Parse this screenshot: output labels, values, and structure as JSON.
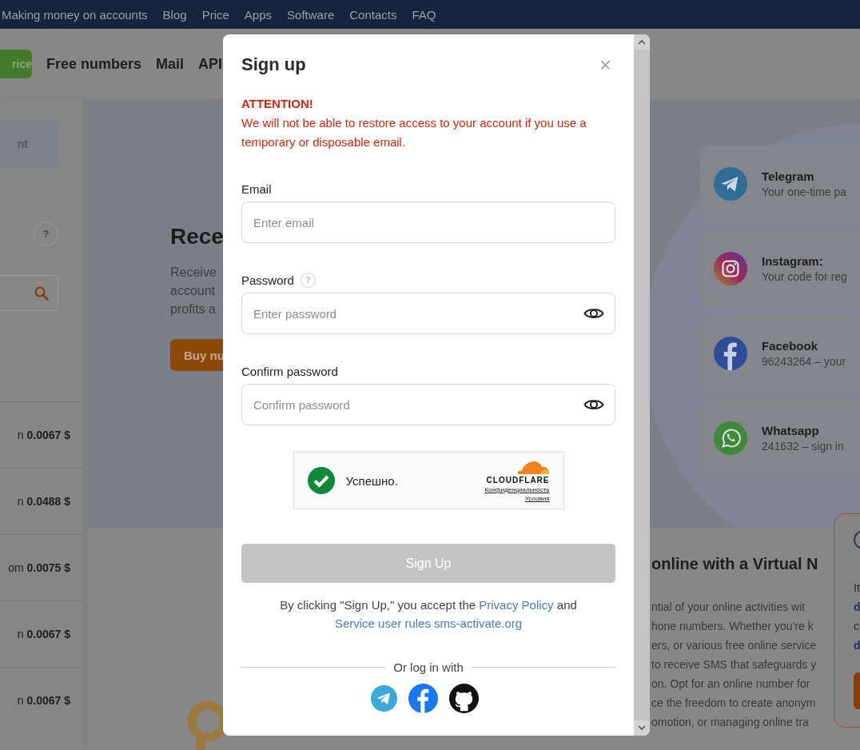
{
  "nav": {
    "links": [
      "Making money on accounts",
      "Blog",
      "Price",
      "Apps",
      "Software",
      "Contacts",
      "FAQ"
    ]
  },
  "header": {
    "price_button": "rice",
    "links": [
      "Free numbers",
      "Mail",
      "API"
    ]
  },
  "sidebar": {
    "tab": "nt",
    "help": "?",
    "price_rows": [
      {
        "prefix": "n",
        "price": "0.0067 $"
      },
      {
        "prefix": "n",
        "price": "0.0488 $"
      },
      {
        "prefix": "om",
        "price": "0.0075 $"
      },
      {
        "prefix": "n",
        "price": "0.0067 $"
      },
      {
        "prefix": "n",
        "price": "0.0067 $"
      }
    ]
  },
  "hero": {
    "title": "Rece",
    "text_lines": [
      "Receive",
      "account",
      "profits a"
    ],
    "button": "Buy nu"
  },
  "service_cards": [
    {
      "kind": "telegram",
      "name": "Telegram",
      "text": "Your one-time pa"
    },
    {
      "kind": "instagram",
      "name": "Instagram:",
      "text": "Your code for reg"
    },
    {
      "kind": "facebook",
      "name": "Facebook",
      "text": "96243264 – your"
    },
    {
      "kind": "whatsapp",
      "name": "Whatsapp",
      "text": "241632 – sign in"
    }
  ],
  "article": {
    "heading": "online with a Virtual N",
    "lines": [
      "ntial of your online activities wit",
      "hone numbers. Whether you're k",
      "ers, or various free online service",
      "to receive SMS that safeguards y",
      "on. Opt for an online number for",
      "ce the freedom to create anonym",
      "omotion, or managing online tra"
    ]
  },
  "popup": {
    "lines": [
      {
        "kind": "text",
        "text": "It"
      },
      {
        "kind": "link",
        "text": "d"
      },
      {
        "kind": "text",
        "text": "c"
      },
      {
        "kind": "link",
        "text": "d"
      }
    ]
  },
  "modal": {
    "title": "Sign up",
    "close": "×",
    "warning_title": "ATTENTION!",
    "warning_text": "We will not be able to restore access to your account if you use a temporary or disposable email.",
    "fields": [
      {
        "label": "Email",
        "placeholder": "Enter email",
        "reveal": false
      },
      {
        "label": "Password",
        "help": "?",
        "placeholder": "Enter password",
        "reveal": true
      },
      {
        "label": "Confirm password",
        "placeholder": "Confirm password",
        "reveal": true
      }
    ],
    "captcha": {
      "verified": true,
      "status": "Успешно.",
      "brand": "CLOUDFLARE",
      "links": [
        "Конфиденциальность",
        "Условия"
      ]
    },
    "submit": {
      "label": "Sign Up",
      "disabled": true
    },
    "terms": [
      {
        "kind": "text",
        "text": "By clicking \"Sign Up,\" you accept the "
      },
      {
        "kind": "link",
        "text": "Privacy Policy"
      },
      {
        "kind": "text",
        "text": " and "
      },
      {
        "kind": "link",
        "text": "Service user rules sms-activate.org"
      }
    ],
    "social_label": "Or log in with",
    "social": [
      {
        "kind": "telegram"
      },
      {
        "kind": "facebook"
      },
      {
        "kind": "github"
      }
    ]
  }
}
